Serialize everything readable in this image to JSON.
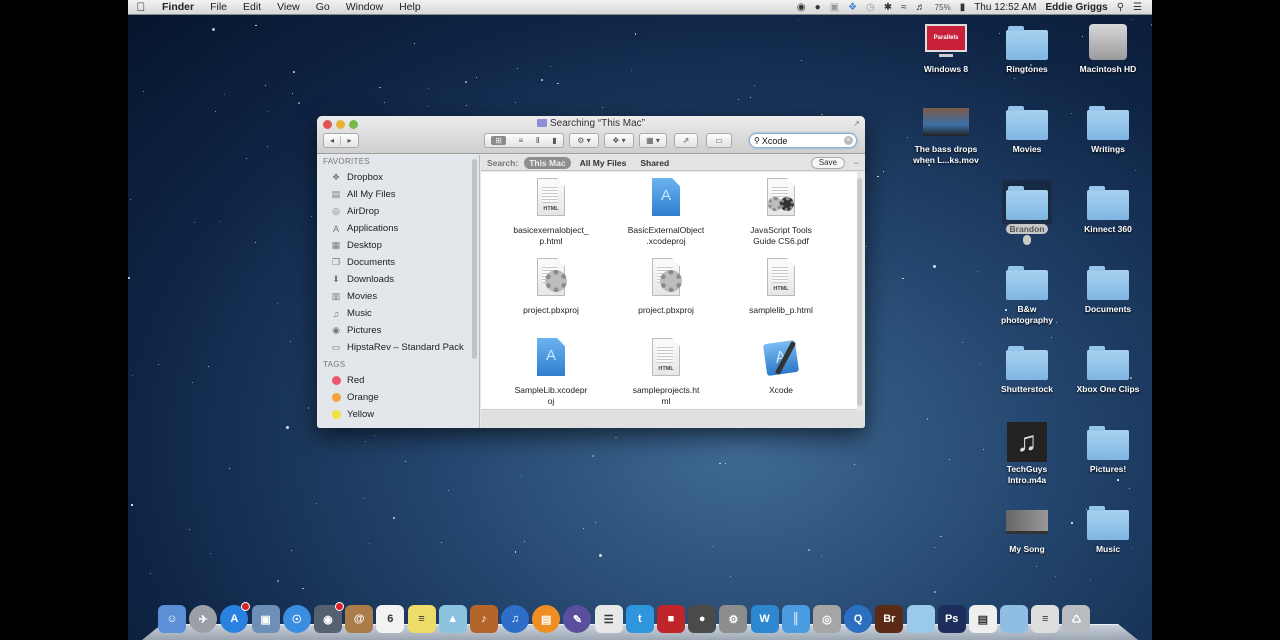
{
  "menubar": {
    "apple_icon": "apple-icon",
    "app_name": "Finder",
    "menus": [
      "File",
      "Edit",
      "View",
      "Go",
      "Window",
      "Help"
    ],
    "status_icons": [
      "record-icon",
      "mustache-icon",
      "camera-icon",
      "dropbox-icon",
      "time-machine-icon",
      "bluetooth-icon",
      "wifi-icon",
      "volume-icon"
    ],
    "battery": "75%",
    "clock": "Thu 12:52 AM",
    "user": "Eddie Griggs",
    "spotlight_icon": "search-icon",
    "notifications_icon": "list-icon"
  },
  "finder": {
    "title": "Searching “This Mac”",
    "back": "◂",
    "forward": "▸",
    "toolbar": {
      "view_icon": "⊞",
      "list_icon": "≡",
      "columns_icon": "Ⅱ",
      "coverflow_icon": "▮",
      "action_icon": "⚙ ▾",
      "dropbox_icon": "❖ ▾",
      "arrange_icon": "▦ ▾",
      "share_icon": "⇗",
      "tags_icon": "▭"
    },
    "search": {
      "value": "Xcode",
      "clear": "×"
    },
    "scope": {
      "label": "Search:",
      "options": [
        "This Mac",
        "All My Files",
        "Shared"
      ],
      "active": "This Mac",
      "save": "Save",
      "minus": "−"
    },
    "sidebar": {
      "favorites_header": "FAVORITES",
      "favorites": [
        {
          "label": "Dropbox",
          "icon": "❖"
        },
        {
          "label": "All My Files",
          "icon": "▤"
        },
        {
          "label": "AirDrop",
          "icon": "◎"
        },
        {
          "label": "Applications",
          "icon": "A"
        },
        {
          "label": "Desktop",
          "icon": "▦"
        },
        {
          "label": "Documents",
          "icon": "❐"
        },
        {
          "label": "Downloads",
          "icon": "⬇"
        },
        {
          "label": "Movies",
          "icon": "▥"
        },
        {
          "label": "Music",
          "icon": "♫"
        },
        {
          "label": "Pictures",
          "icon": "◉"
        },
        {
          "label": "HipstaRev –  Standard Pack",
          "icon": "▭"
        }
      ],
      "tags_header": "TAGS",
      "tags": [
        {
          "label": "Red",
          "color": "#e85a6a"
        },
        {
          "label": "Orange",
          "color": "#f6a33a"
        },
        {
          "label": "Yellow",
          "color": "#f1e33e"
        }
      ]
    },
    "results": [
      {
        "line1": "basicexernalobject_",
        "line2": "p.html",
        "type": "html"
      },
      {
        "line1": "BasicExternalObject",
        ".": "",
        "line2": ".xcodeproj",
        "type": "xcodeproj"
      },
      {
        "line1": "JavaScript Tools",
        "line2": "Guide CS6.pdf",
        "type": "pdf"
      },
      {
        "line1": "project.pbxproj",
        "line2": "",
        "type": "pbxproj"
      },
      {
        "line1": "project.pbxproj",
        "line2": "",
        "type": "pbxproj"
      },
      {
        "line1": "samplelib_p.html",
        "line2": "",
        "type": "html"
      },
      {
        "line1": "SampleLib.xcodepr",
        "line2": "oj",
        "type": "xcodeproj"
      },
      {
        "line1": "sampleprojects.ht",
        "line2": "ml",
        "type": "html"
      },
      {
        "line1": "Xcode",
        "line2": "",
        "type": "app"
      }
    ],
    "html_tag": "HTML",
    "appstore_glyph": "A"
  },
  "desktop": {
    "icons": [
      {
        "label1": "Windows 8",
        "label2": "",
        "kind": "parallels",
        "badge": "Parallels"
      },
      {
        "label1": "Ringtones",
        "label2": "",
        "kind": "folder"
      },
      {
        "label1": "Macintosh HD",
        "label2": "",
        "kind": "disk"
      },
      {
        "label1": "The bass drops",
        "label2": "when L...ks.mov",
        "kind": "movie"
      },
      {
        "label1": "Movies",
        "label2": "",
        "kind": "folder"
      },
      {
        "label1": "Writings",
        "label2": "",
        "kind": "folder"
      },
      {
        "label1": "Brandon",
        "label2": "",
        "kind": "folder",
        "selected": true
      },
      {
        "label1": "Kinnect 360",
        "label2": "",
        "kind": "folder"
      },
      {
        "label1": "B&w",
        "label2": "photography",
        "kind": "folder"
      },
      {
        "label1": "Documents",
        "label2": "",
        "kind": "folder"
      },
      {
        "label1": "Shutterstock",
        "label2": "",
        "kind": "folder"
      },
      {
        "label1": "Xbox One Clips",
        "label2": "",
        "kind": "folder"
      },
      {
        "label1": "TechGuys",
        "label2": "Intro.m4a",
        "kind": "audio"
      },
      {
        "label1": "Pictures!",
        "label2": "",
        "kind": "folder"
      },
      {
        "label1": "My Song",
        "label2": "",
        "kind": "garageband"
      },
      {
        "label1": "Music",
        "label2": "",
        "kind": "folder"
      }
    ]
  },
  "dock": {
    "apps": [
      {
        "name": "finder",
        "glyph": "☺",
        "color": "#5b8fd6"
      },
      {
        "name": "launchpad",
        "glyph": "✈",
        "color": "#9a9ea6"
      },
      {
        "name": "app-store",
        "glyph": "A",
        "color": "#2a82e0",
        "badge": true
      },
      {
        "name": "preview",
        "glyph": "▣",
        "color": "#6d8fb8"
      },
      {
        "name": "safari",
        "glyph": "☉",
        "color": "#3a8de0"
      },
      {
        "name": "facetime",
        "glyph": "◉",
        "color": "#556070",
        "badge": true
      },
      {
        "name": "contacts",
        "glyph": "@",
        "color": "#a97c4a"
      },
      {
        "name": "calendar",
        "glyph": "6",
        "color": "#f2f2f2"
      },
      {
        "name": "notes",
        "glyph": "≡",
        "color": "#eedc6a"
      },
      {
        "name": "maps",
        "glyph": "▲",
        "color": "#8cc4e0"
      },
      {
        "name": "garageband",
        "glyph": "♪",
        "color": "#b5652a"
      },
      {
        "name": "itunes",
        "glyph": "♫",
        "color": "#2d6ec8"
      },
      {
        "name": "ibooks",
        "glyph": "▤",
        "color": "#ee8f24"
      },
      {
        "name": "script-editor",
        "glyph": "✎",
        "color": "#5a4f9c"
      },
      {
        "name": "textedit",
        "glyph": "☰",
        "color": "#e8e8e8"
      },
      {
        "name": "twitter",
        "glyph": "t",
        "color": "#2f95dc"
      },
      {
        "name": "photo-booth",
        "glyph": "■",
        "color": "#c0252a"
      },
      {
        "name": "steam",
        "glyph": "●",
        "color": "#4a4a4a"
      },
      {
        "name": "system-preferences",
        "glyph": "⚙",
        "color": "#8d8d8d"
      },
      {
        "name": "word",
        "glyph": "W",
        "color": "#2d88d0"
      },
      {
        "name": "parallels",
        "glyph": "║",
        "color": "#4b9be0"
      },
      {
        "name": "disk-utility",
        "glyph": "◎",
        "color": "#a6a6a6"
      },
      {
        "name": "quicktime",
        "glyph": "Q",
        "color": "#2a6fc0"
      },
      {
        "name": "bridge",
        "glyph": "Br",
        "color": "#5a2a14"
      },
      {
        "name": "applications-folder",
        "glyph": "",
        "color": "#9bc9ea"
      },
      {
        "name": "photoshop",
        "glyph": "Ps",
        "color": "#1e2e5c"
      },
      {
        "name": "document",
        "glyph": "▤",
        "color": "#efefef"
      },
      {
        "name": "downloads-folder",
        "glyph": "",
        "color": "#8fbde4"
      },
      {
        "name": "recent-document",
        "glyph": "≡",
        "color": "#dedede"
      },
      {
        "name": "trash",
        "glyph": "♺",
        "color": "#b8bcc0"
      }
    ]
  }
}
